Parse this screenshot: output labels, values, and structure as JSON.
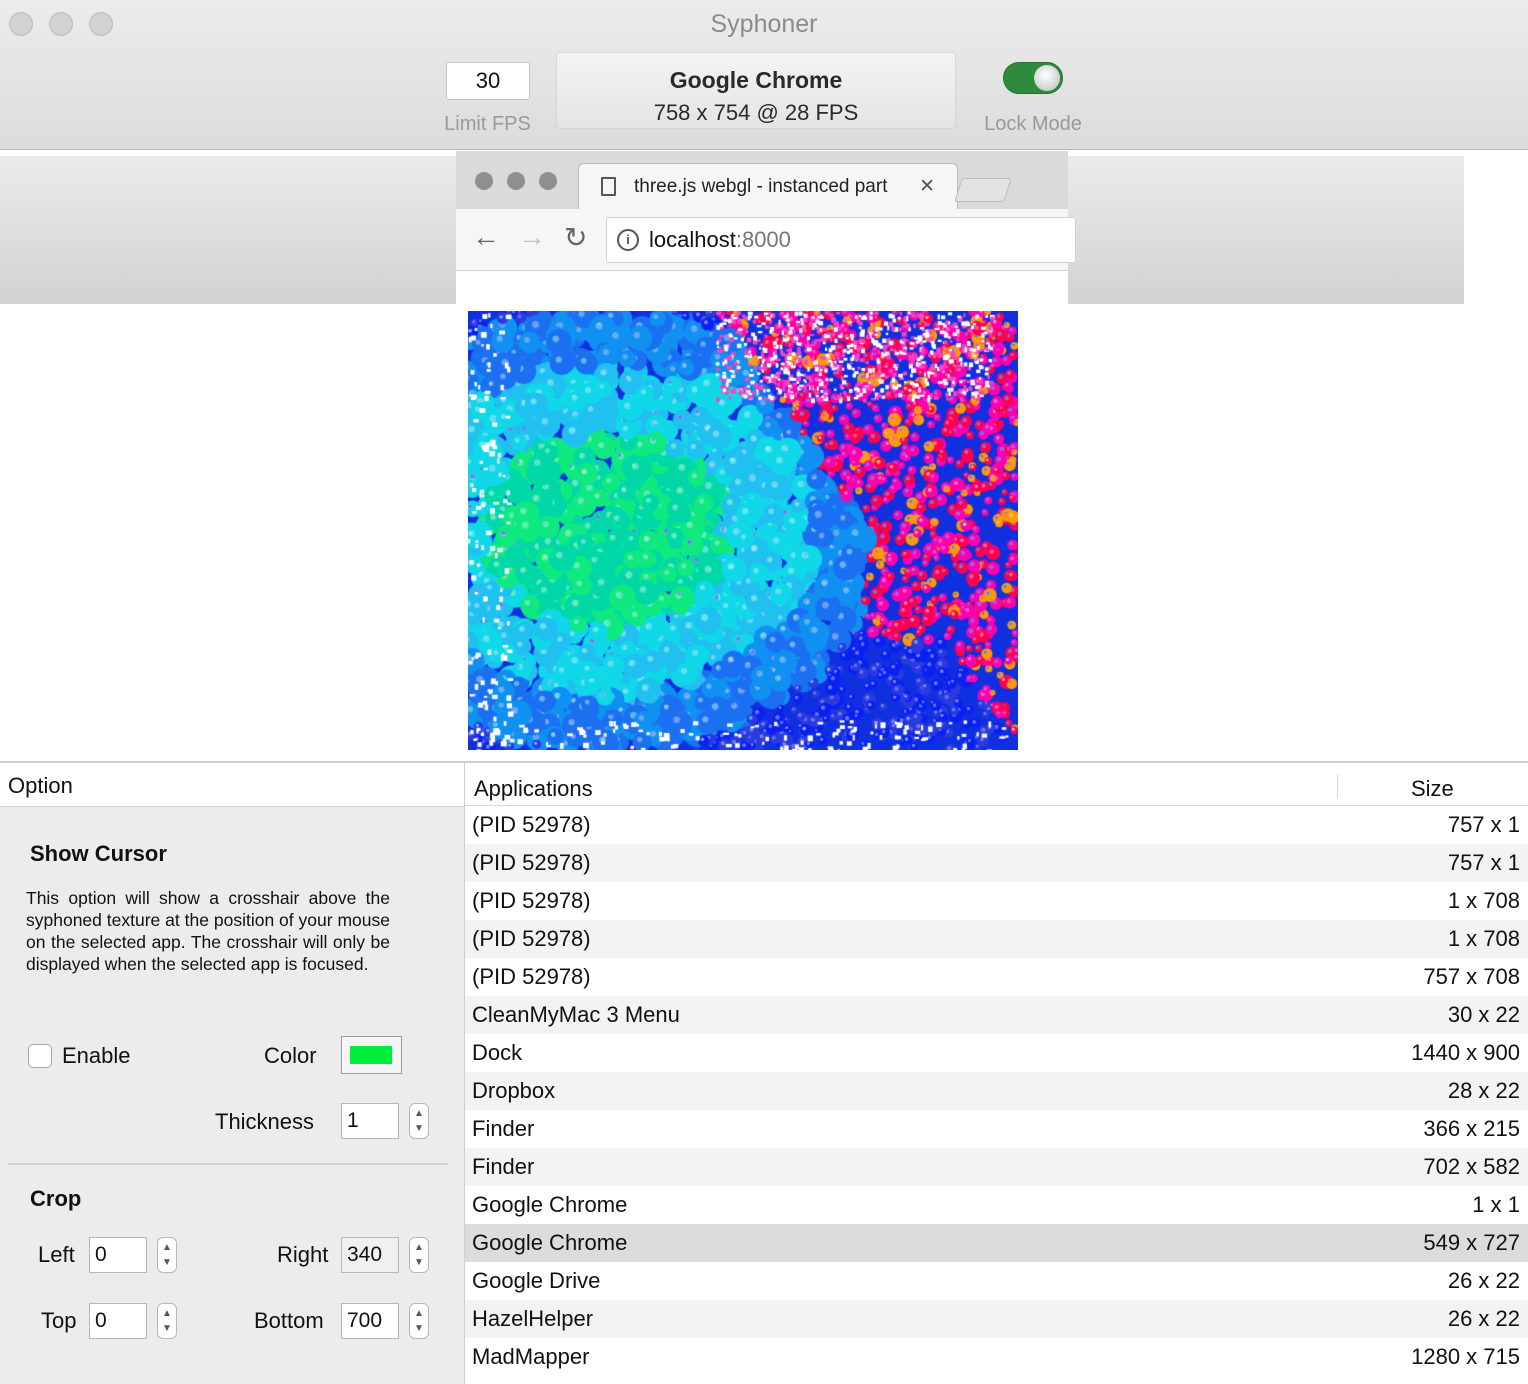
{
  "window": {
    "title": "Syphoner"
  },
  "toolbar": {
    "fps_value": "30",
    "fps_label": "Limit FPS",
    "source_name": "Google Chrome",
    "source_info": "758 x 754 @ 28 FPS",
    "lock_label": "Lock Mode",
    "lock_on": true,
    "toggle_color": "#2e8b3e"
  },
  "preview": {
    "tab_title": "three.js webgl - instanced part",
    "url_host": "localhost",
    "url_port": ":8000"
  },
  "options": {
    "header": "Option",
    "show_cursor_title": "Show Cursor",
    "show_cursor_desc": "This option will show a crosshair above the syphoned texture at the position of your mouse on the selected app. The crosshair will only be displayed when the selected app is focused.",
    "enable_label": "Enable",
    "enable_checked": false,
    "color_label": "Color",
    "crosshair_color": "#00ee3c",
    "thickness_label": "Thickness",
    "thickness_value": "1",
    "crop_title": "Crop",
    "left_label": "Left",
    "left_value": "0",
    "right_label": "Right",
    "right_value": "340",
    "top_label": "Top",
    "top_value": "0",
    "bottom_label": "Bottom",
    "bottom_value": "700"
  },
  "apps": {
    "col_applications": "Applications",
    "col_size": "Size",
    "selected_index": 11,
    "rows": [
      {
        "name": "(PID 52978)",
        "size": "757 x 1"
      },
      {
        "name": "(PID 52978)",
        "size": "757 x 1"
      },
      {
        "name": "(PID 52978)",
        "size": "1 x 708"
      },
      {
        "name": "(PID 52978)",
        "size": "1 x 708"
      },
      {
        "name": "(PID 52978)",
        "size": "757 x 708"
      },
      {
        "name": "CleanMyMac 3 Menu",
        "size": "30 x 22"
      },
      {
        "name": "Dock",
        "size": "1440 x 900"
      },
      {
        "name": "Dropbox",
        "size": "28 x 22"
      },
      {
        "name": "Finder",
        "size": "366 x 215"
      },
      {
        "name": "Finder",
        "size": "702 x 582"
      },
      {
        "name": "Google Chrome",
        "size": "1 x 1"
      },
      {
        "name": "Google Chrome",
        "size": "549 x 727"
      },
      {
        "name": "Google Drive",
        "size": "26 x 22"
      },
      {
        "name": "HazelHelper",
        "size": "26 x 22"
      },
      {
        "name": "MadMapper",
        "size": "1280 x 715"
      }
    ]
  }
}
